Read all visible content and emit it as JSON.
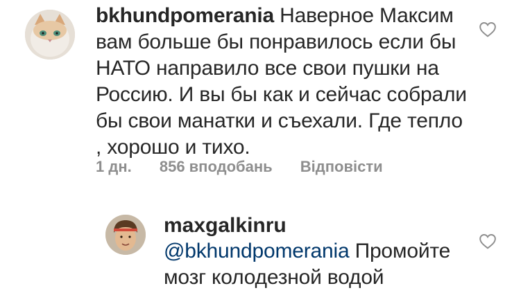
{
  "comment1": {
    "username": "bkhundpomerania",
    "text": "Наверное Максим вам больше бы понравилось если бы НАТО направило все свои пушки на Россию.  И вы бы как и сейчас собрали бы свои манатки и съехали. Где тепло , хорошо и тихо.",
    "time": "1 дн.",
    "likes": "856 вподобань",
    "reply_label": "Відповісти",
    "avatar_icon": "cat-avatar-icon",
    "like_icon": "heart-outline-icon"
  },
  "comment2": {
    "username": "maxgalkinru",
    "mention": "@bkhundpomerania",
    "text": "Промойте мозг колодезной водой",
    "avatar_icon": "user-avatar-icon",
    "like_icon": "heart-outline-icon"
  },
  "colors": {
    "text": "#262626",
    "secondary": "#8e8e8e",
    "mention": "#00376b"
  }
}
